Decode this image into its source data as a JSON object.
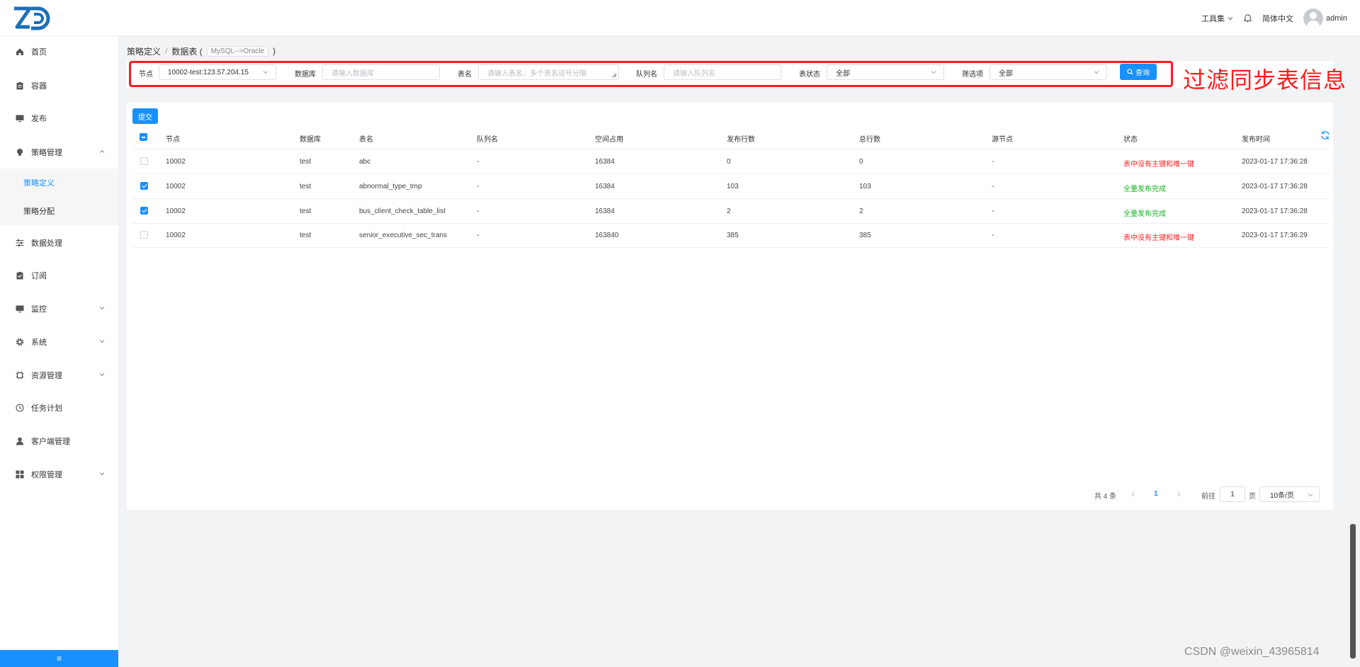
{
  "header": {
    "logo_text": "ZD",
    "toolbox_label": "工具集",
    "language_label": "简体中文",
    "user_name": "admin"
  },
  "sidebar": {
    "items": [
      {
        "label": "首页",
        "icon": "home-icon"
      },
      {
        "label": "容器",
        "icon": "clipboard-icon"
      },
      {
        "label": "发布",
        "icon": "monitor-icon"
      },
      {
        "label": "策略管理",
        "icon": "bulb-icon",
        "expanded": true
      },
      {
        "label": "策略定义",
        "sub": true,
        "active": true
      },
      {
        "label": "策略分配",
        "sub": true
      },
      {
        "label": "数据处理",
        "icon": "sliders-icon"
      },
      {
        "label": "订阅",
        "icon": "clipboard-check-icon"
      },
      {
        "label": "监控",
        "icon": "monitor-icon"
      },
      {
        "label": "系统",
        "icon": "gear-icon"
      },
      {
        "label": "资源管理",
        "icon": "chip-icon"
      },
      {
        "label": "任务计划",
        "icon": "clock-icon"
      },
      {
        "label": "客户端管理",
        "icon": "user-icon"
      },
      {
        "label": "权限管理",
        "icon": "grid-icon"
      }
    ],
    "collapse_glyph": "≡"
  },
  "breadcrumb": {
    "level1": "策略定义",
    "separator": "/",
    "level2": "数据表 (",
    "tag": "MySQL-->Oracle",
    "close": ")"
  },
  "filters": {
    "node_label": "节点",
    "node_value": "10002-test:123.57.204.15",
    "db_label": "数据库",
    "db_placeholder": "请输入数据库",
    "table_label": "表名",
    "table_placeholder": "请输入表名，多个表名逗号分隔",
    "queue_label": "队列名",
    "queue_placeholder": "请输入队列名",
    "status_label": "表状态",
    "status_value": "全部",
    "filter_label": "筛选项",
    "filter_value": "全部",
    "query_label": "查询"
  },
  "annotation": "过滤同步表信息",
  "submit_label": "提交",
  "table": {
    "headers": [
      "节点",
      "数据库",
      "表名",
      "队列名",
      "空间占用",
      "发布行数",
      "总行数",
      "源节点",
      "状态",
      "发布时间"
    ],
    "rows": [
      {
        "checked": false,
        "cells": [
          "10002",
          "test",
          "abc",
          "-",
          "16384",
          "0",
          "0",
          "-",
          "表中没有主键和唯一键",
          "2023-01-17 17:36:28"
        ],
        "status_color": "#ff2222"
      },
      {
        "checked": true,
        "cells": [
          "10002",
          "test",
          "abnormal_type_tmp",
          "-",
          "16384",
          "103",
          "103",
          "-",
          "全量发布完成",
          "2023-01-17 17:36:28"
        ],
        "status_color": "#18b024"
      },
      {
        "checked": true,
        "cells": [
          "10002",
          "test",
          "bus_client_check_table_list",
          "-",
          "16384",
          "2",
          "2",
          "-",
          "全量发布完成",
          "2023-01-17 17:36:28"
        ],
        "status_color": "#18b024"
      },
      {
        "checked": false,
        "cells": [
          "10002",
          "test",
          "senior_executive_sec_trans",
          "-",
          "163840",
          "385",
          "385",
          "-",
          "表中没有主键和唯一键",
          "2023-01-17 17:36:29"
        ],
        "status_color": "#ff2222"
      }
    ]
  },
  "pagination": {
    "total": "共 4 条",
    "current_page": "1",
    "goto_label": "前往",
    "goto_value": "1",
    "page_unit": "页",
    "page_size": "10条/页"
  },
  "watermark": "CSDN @weixin_43965814",
  "colors": {
    "accent": "#1890ff",
    "error": "#ff2222",
    "success": "#18b024",
    "highlight": "#ff1a1a"
  }
}
